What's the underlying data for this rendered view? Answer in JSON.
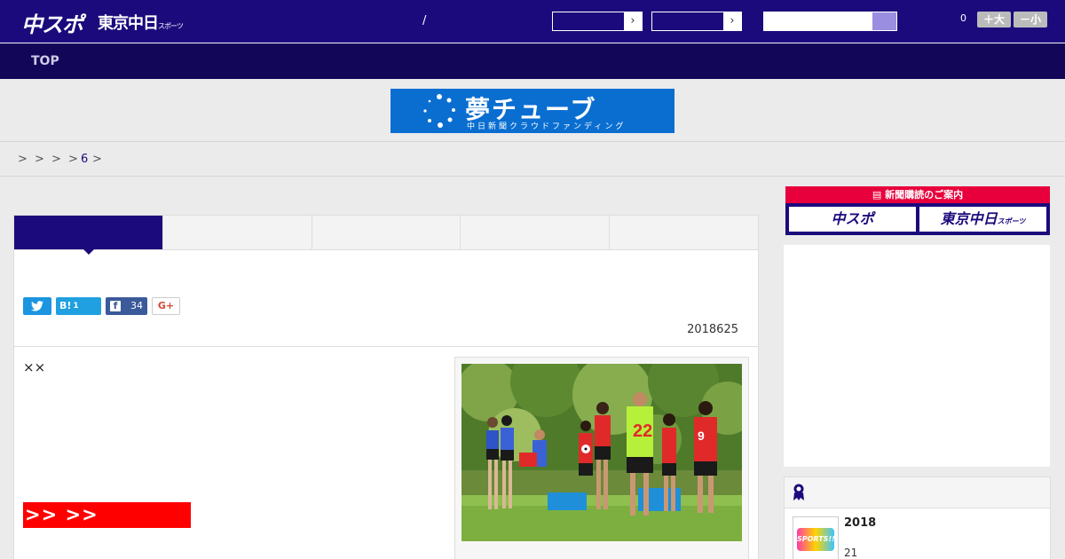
{
  "header": {
    "logo_main": "中スポ",
    "logo_tokyo": "東京中日",
    "logo_tokyo_small": "スポーツ",
    "separator": "/",
    "font_size_count": "0",
    "font_larger_label": "＋大",
    "font_smaller_label": "－小"
  },
  "nav": {
    "top_label": "TOP"
  },
  "banner": {
    "title": "夢チューブ",
    "subtitle": "中日新聞クラウドファンディング"
  },
  "breadcrumb": {
    "items": [
      ">",
      ">",
      ">",
      ">",
      "6",
      ">"
    ]
  },
  "article": {
    "share": {
      "hatena_label": "B!",
      "hatena_count": "1",
      "facebook_count": "34",
      "google_label": "G+"
    },
    "date": "2018625",
    "body_text": "××",
    "red_link_label": ">> >>"
  },
  "sidebar": {
    "subscribe_heading": "新聞購読のご案内",
    "subscribe_chunichi": "中スポ",
    "subscribe_tokyo": "東京中日",
    "subscribe_tokyo_small": "スポーツ",
    "ranking": {
      "item_title": "2018",
      "item_sub": "21",
      "thumb_label": "SPORTS!!"
    }
  },
  "colors": {
    "header_bg": "#1b0a7c",
    "nav_bg": "#120658",
    "banner_bg": "#0a6ed1",
    "accent_red": "#ff0000",
    "subscribe_red": "#e8003c"
  }
}
